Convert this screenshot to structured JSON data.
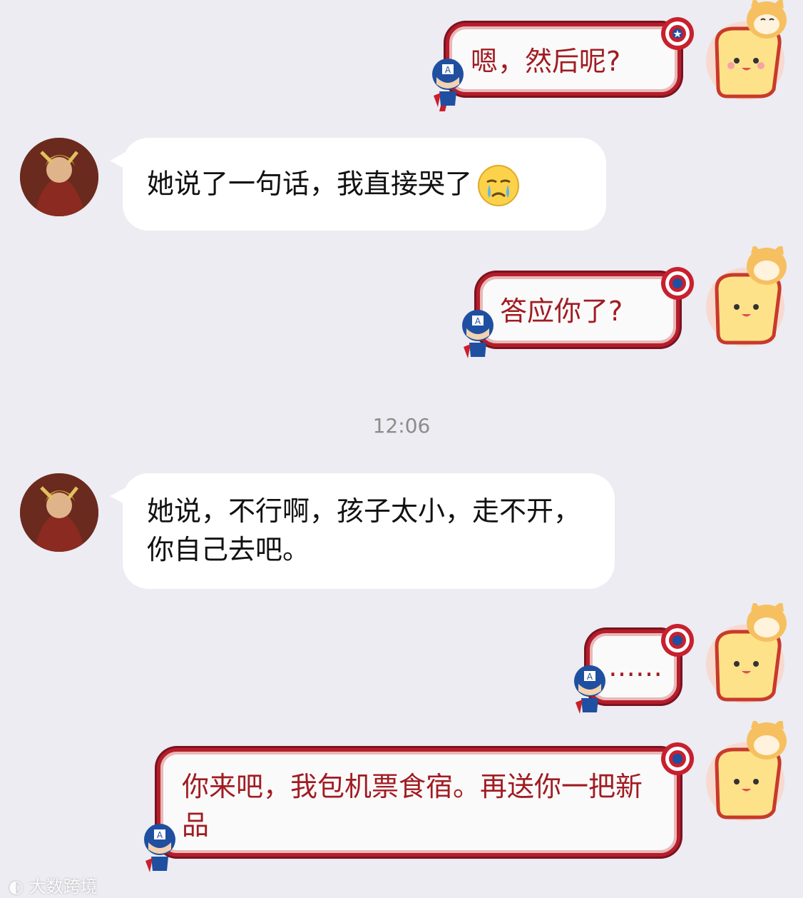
{
  "messages": [
    {
      "side": "out",
      "text": "嗯，然后呢?"
    },
    {
      "side": "in",
      "text": "她说了一句话，我直接哭了",
      "emoji": "crying-face-emoji"
    },
    {
      "side": "out",
      "text": "答应你了?"
    },
    {
      "side": "in",
      "text": "她说，不行啊，孩子太小，走不开，你自己去吧。"
    },
    {
      "side": "out",
      "text": "……"
    },
    {
      "side": "out",
      "text": "你来吧，我包机票食宿。再送你一把新品"
    }
  ],
  "timestamp": "12:06",
  "watermark": {
    "text": "大数跨境",
    "icon": "weibo-logo-icon"
  },
  "colors": {
    "background": "#ececf2",
    "incoming_bubble": "#ffffff",
    "outgoing_border": "#b51d2b",
    "outgoing_text": "#a01c22",
    "timestamp": "#8c8c8c"
  }
}
